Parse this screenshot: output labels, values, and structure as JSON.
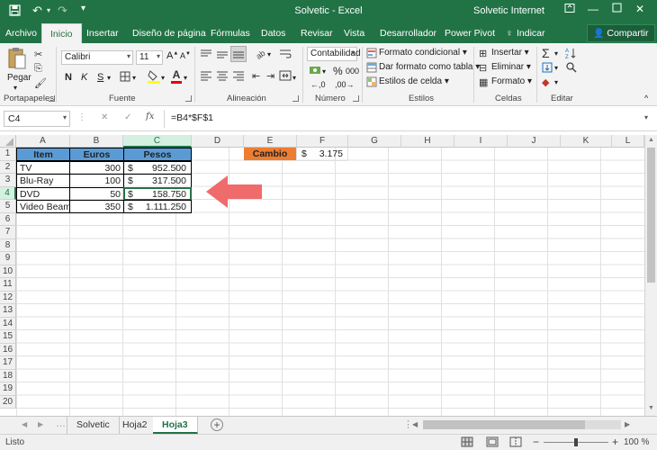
{
  "window": {
    "title": "Solvetic  -  Excel",
    "account": "Solvetic Internet",
    "save_icon": "save-icon",
    "undo_icon": "undo-icon",
    "redo_icon": "redo-icon",
    "customize_icon": "customize-icon",
    "ribbon_display_icon": "ribbon-display-icon",
    "minimize_icon": "minimize-icon",
    "maximize_icon": "maximize-icon",
    "close_icon": "close-icon"
  },
  "tabs": [
    "Archivo",
    "Inicio",
    "Insertar",
    "Diseño de página",
    "Fórmulas",
    "Datos",
    "Revisar",
    "Vista",
    "Desarrollador",
    "Power Pivot"
  ],
  "tell_me": "Indicar",
  "share": "Compartir",
  "ribbon": {
    "paste_label": "Pegar",
    "font_name": "Calibri",
    "font_size": "11",
    "bold": "N",
    "italic": "K",
    "underline": "S",
    "number_format": "Contabilidad",
    "percent": "%",
    "thousands": "000",
    "cond_format": "Formato condicional",
    "table_format": "Dar formato como tabla",
    "cell_styles": "Estilos de celda",
    "insert": "Insertar",
    "delete": "Eliminar",
    "format": "Formato",
    "groups": {
      "clipboard": "Portapapeles",
      "font": "Fuente",
      "alignment": "Alineación",
      "number": "Número",
      "styles": "Estilos",
      "cells": "Celdas",
      "editing": "Editar"
    }
  },
  "formula_bar": {
    "name_box": "C4",
    "cancel": "✕",
    "enter": "✓",
    "fx": "fx",
    "formula": "=B4*$F$1"
  },
  "grid": {
    "columns": [
      "A",
      "B",
      "C",
      "D",
      "E",
      "F",
      "G",
      "H",
      "I",
      "J",
      "K",
      "L"
    ],
    "rows": [
      "1",
      "2",
      "3",
      "4",
      "5",
      "6",
      "7",
      "8",
      "9",
      "10",
      "11",
      "12",
      "13",
      "14",
      "15",
      "16",
      "17",
      "18",
      "19",
      "20"
    ],
    "headers": {
      "item": "Item",
      "euros": "Euros",
      "pesos": "Pesos"
    },
    "data": [
      {
        "item": "TV",
        "euros": "300",
        "currency": "$",
        "pesos": "952.500"
      },
      {
        "item": "Blu-Ray",
        "euros": "100",
        "currency": "$",
        "pesos": "317.500"
      },
      {
        "item": "DVD",
        "euros": "50",
        "currency": "$",
        "pesos": "158.750"
      },
      {
        "item": "Video Beam",
        "euros": "350",
        "currency": "$",
        "pesos": "1.111.250"
      }
    ],
    "cambio_label": "Cambio",
    "cambio_currency": "$",
    "cambio_value": "3.175"
  },
  "sheets": [
    "Solvetic",
    "Hoja2",
    "Hoja3"
  ],
  "status": {
    "ready": "Listo",
    "zoom_out": "−",
    "zoom_in": "+",
    "zoom": "100 %"
  }
}
